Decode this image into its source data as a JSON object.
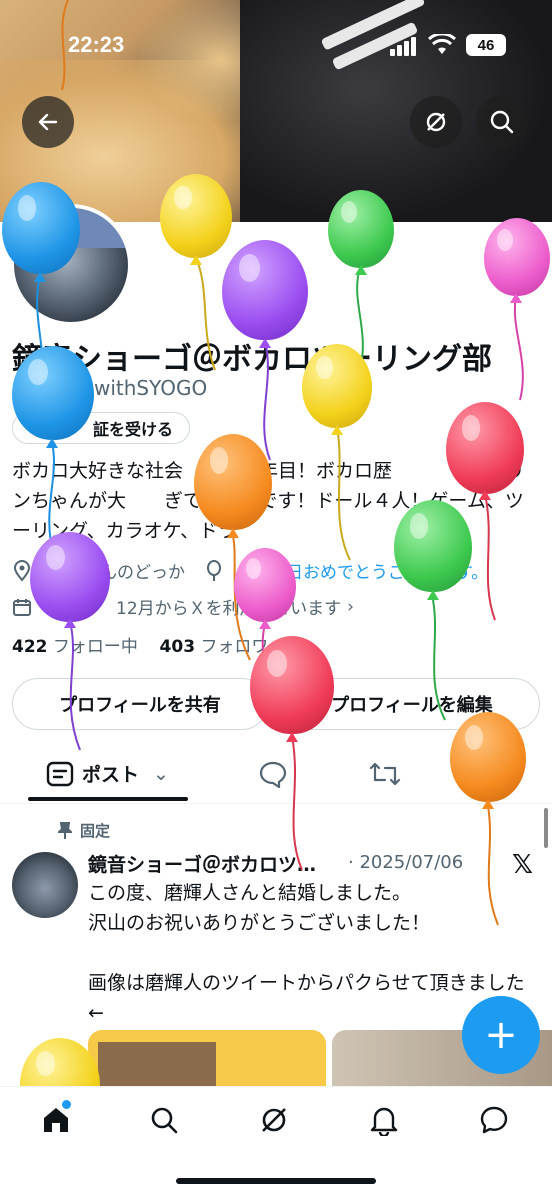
{
  "status_bar": {
    "time": "22:23",
    "battery": "46"
  },
  "header": {
    "back_icon": "arrow-left-icon",
    "grok_icon": "grok-icon",
    "search_icon": "search-icon"
  },
  "profile": {
    "display_name": "鏡音ショーゴ＠ボカロツーリング部",
    "handle": "withSYOGO",
    "verify_button": "証を受ける",
    "bio": "ボカロ大好きな社会　　民２年目！ボカロ歴　　　です！リンちゃんが大　　ぎてやばいです！ドール４人！ゲーム、ツーリング、カラオケ、ドラ",
    "location": "んのどっか",
    "birthday": "生日おめでとうございます。",
    "joined": "12月からＸを利用しています",
    "following_count": "422",
    "following_label": "フォロー中",
    "followers_count": "403",
    "followers_label": "フォロワ"
  },
  "actions": {
    "share": "プロフィールを共有",
    "edit": "プロフィールを編集"
  },
  "tabs": {
    "active_label": "ポスト"
  },
  "post": {
    "pinned_label": "固定",
    "author": "鏡音ショーゴ＠ボカロツ…",
    "date": "· 2025/07/06",
    "text": "この度、磨輝人さんと結婚しました。\n沢山のお祝いありがとうございました！\n\n画像は磨輝人のツイートからパクらせて頂きました←"
  },
  "fab_label": "+",
  "nav": [
    "home-icon",
    "search-icon",
    "grok-icon",
    "notifications-icon",
    "messages-icon"
  ],
  "colors": {
    "accent": "#1d9bf0",
    "text": "#0f1419",
    "secondary": "#536471"
  }
}
